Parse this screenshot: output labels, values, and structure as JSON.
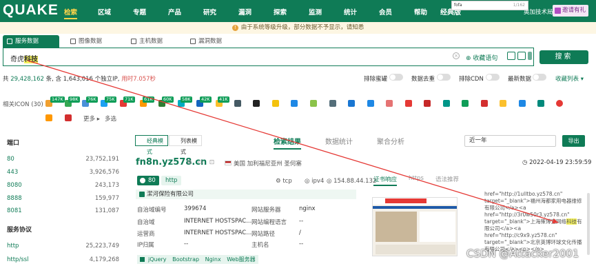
{
  "nav": {
    "logo": "QUAKE",
    "items": [
      "检索",
      "区域",
      "专题",
      "产品",
      "研究",
      "漏洞",
      "探索",
      "监测",
      "统计",
      "会员",
      "帮助"
    ],
    "version": "经典版",
    "user": "奥加技术局",
    "invite": "邀请有礼",
    "popup_text": "fofa",
    "popup_count": "1/162"
  },
  "notice": "由于系统等级升级，部分数据不予显示，请知悉",
  "data_tabs": [
    "服务数据",
    "图像数据",
    "主机数据",
    "漏洞数据"
  ],
  "search": {
    "query_prefix": "奇虎",
    "query_highlight": "科技",
    "fav": "收藏语句",
    "button": "搜索"
  },
  "stats": {
    "prefix": "共",
    "total": "29,428,162",
    "mid": "条, 含",
    "ip_count": "1,643,016",
    "ip_label": "个独立IP,",
    "time": "用时7.057秒"
  },
  "toggles": [
    "排除蜜罐",
    "数据去重",
    "排除CDN",
    "最新数据"
  ],
  "fav_list": "收藏列表",
  "icon_row": {
    "label": "相关ICON (30)",
    "badges": [
      "147K",
      "98K",
      "76K",
      "75K",
      "71K",
      "61K",
      "60K",
      "58K",
      "42K",
      "41K"
    ],
    "more": "更多",
    "multi": "多选"
  },
  "left_panel": {
    "port_title": "端口",
    "ports": [
      {
        "k": "80",
        "v": "23,752,191"
      },
      {
        "k": "443",
        "v": "3,926,576"
      },
      {
        "k": "8080",
        "v": "243,173"
      },
      {
        "k": "8888",
        "v": "159,977"
      },
      {
        "k": "8081",
        "v": "131,087"
      }
    ],
    "proto_title": "服务协议",
    "protocols": [
      {
        "k": "http",
        "v": "25,223,749"
      },
      {
        "k": "http/ssl",
        "v": "4,179,268"
      }
    ]
  },
  "mode_tabs": [
    "经典模式",
    "列表模式"
  ],
  "content_tabs": [
    "检索结果",
    "数据统计",
    "聚合分析"
  ],
  "date_range": "近一年",
  "export": "导出",
  "result": {
    "host": "fn8n.yz578.cn",
    "location": "美国 加利福尼亚州 圣何塞",
    "timestamp": "2022-04-19 23:59:59",
    "port": "80",
    "proto": "http",
    "transport": "tcp",
    "ipver": "ipv4",
    "ip": "154.88.44.132",
    "org": "潔河保险有限公司",
    "rows": [
      {
        "k": "自治域编号",
        "v": "399674",
        "k2": "网站服务器",
        "v2": "nginx"
      },
      {
        "k": "自治域",
        "v": "INTERNET HOSTSPAC...",
        "k2": "网站编程语言",
        "v2": "--"
      },
      {
        "k": "运营商",
        "v": "INTERNET HOSTSPAC...",
        "k2": "网站路径",
        "v2": "/"
      },
      {
        "k": "IP归属",
        "v": "--",
        "k2": "主机名",
        "v2": "--"
      }
    ],
    "techs": "jQuery Bootstrap Nginx Web服务器"
  },
  "right_tabs": [
    "证书响应",
    "https",
    "语法推荐"
  ],
  "code": {
    "l1": "href=\"http://1ulltbo.yz578.cn\"",
    "l2": "target=\"_blank\">福州海都家用电器维修",
    "l3": "有限公司</a><a",
    "l4": "href=\"http://3r0w50r3.yz578.cn\"",
    "l5a": "target=\"_blank\">上海策博宣网络",
    "l5h": "科技",
    "l5b": "有",
    "l6": "限公司</a><a",
    "l7": "href=\"http://c9x9.yz578.cn\"",
    "l8": "target=\"_blank\">北京英博环球文化传播",
    "l9": "有限公司</a><p></p>"
  },
  "watermark": "CSDN @Attacker2001"
}
